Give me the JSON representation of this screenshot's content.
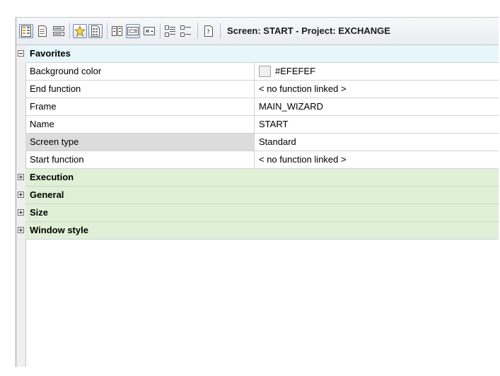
{
  "toolbar": {
    "title": "Screen: START - Project: EXCHANGE",
    "icons": [
      "grid-view-icon",
      "page-icon",
      "list-icon",
      "favorites-star-icon",
      "favorites-list-icon",
      "sort-icon",
      "edit-field-icon",
      "edit-field-alt-icon",
      "expand-all-icon",
      "collapse-all-icon",
      "help-icon"
    ]
  },
  "categories": [
    {
      "label": "Favorites",
      "expanded": true,
      "properties": [
        {
          "name": "Background color",
          "value": "#EFEFEF",
          "swatch": "#EFEFEF"
        },
        {
          "name": "End function",
          "value": "< no function linked >"
        },
        {
          "name": "Frame",
          "value": "MAIN_WIZARD"
        },
        {
          "name": "Name",
          "value": "START"
        },
        {
          "name": "Screen type",
          "value": "Standard",
          "selected": true
        },
        {
          "name": "Start function",
          "value": "< no function linked >"
        }
      ]
    },
    {
      "label": "Execution",
      "expanded": false
    },
    {
      "label": "General",
      "expanded": false
    },
    {
      "label": "Size",
      "expanded": false
    },
    {
      "label": "Window style",
      "expanded": false
    }
  ],
  "colors": {
    "favorites_bg": "#E7F6FB",
    "category_bg": "#DFF0D6",
    "selected_bg": "#DCDCDC",
    "toolbar_bg": "#EBEEF2"
  }
}
